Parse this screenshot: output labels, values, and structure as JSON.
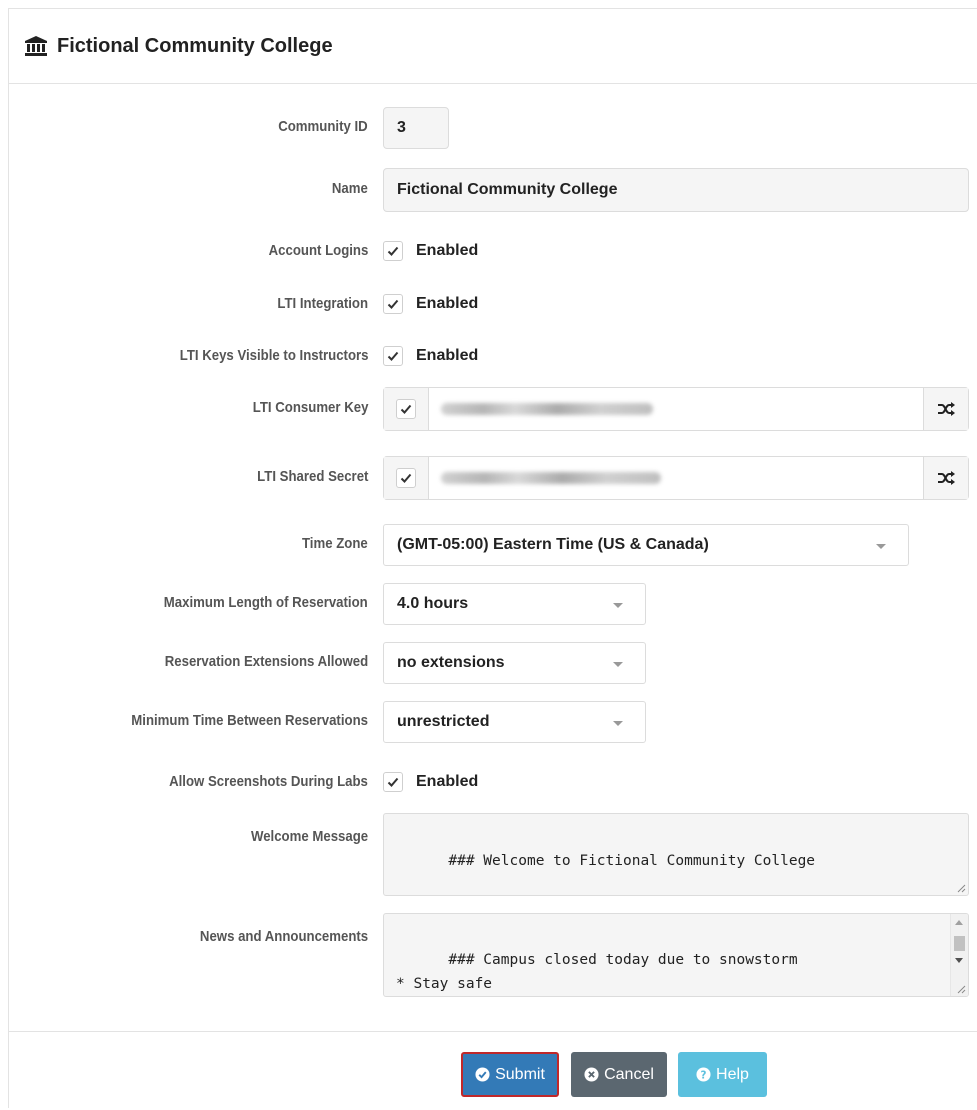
{
  "header": {
    "title": "Fictional Community College",
    "icon": "university-icon"
  },
  "form": {
    "community_id": {
      "label": "Community ID",
      "value": "3"
    },
    "name": {
      "label": "Name",
      "value": "Fictional Community College"
    },
    "account_logins": {
      "label": "Account Logins",
      "checked": true,
      "text": "Enabled"
    },
    "lti_integration": {
      "label": "LTI Integration",
      "checked": true,
      "text": "Enabled"
    },
    "lti_keys_visible": {
      "label": "LTI Keys Visible to Instructors",
      "checked": true,
      "text": "Enabled"
    },
    "lti_consumer_key": {
      "label": "LTI Consumer Key",
      "checked": true,
      "icon": "shuffle-icon"
    },
    "lti_shared_secret": {
      "label": "LTI Shared Secret",
      "checked": true,
      "icon": "shuffle-icon"
    },
    "time_zone": {
      "label": "Time Zone",
      "value": "(GMT-05:00) Eastern Time (US & Canada)"
    },
    "max_reservation": {
      "label": "Maximum Length of Reservation",
      "value": "4.0 hours"
    },
    "extensions": {
      "label": "Reservation Extensions Allowed",
      "value": "no extensions"
    },
    "min_time_between": {
      "label": "Minimum Time Between Reservations",
      "value": "unrestricted"
    },
    "allow_screenshots": {
      "label": "Allow Screenshots During Labs",
      "checked": true,
      "text": "Enabled"
    },
    "welcome_message": {
      "label": "Welcome Message",
      "value": "### Welcome to Fictional Community College"
    },
    "news": {
      "label": "News and Announcements",
      "value": "### Campus closed today due to snowstorm\n* Stay safe\n* Complete your assignments using NETLAB+"
    }
  },
  "buttons": {
    "submit": "Submit",
    "cancel": "Cancel",
    "help": "Help"
  },
  "colors": {
    "submit": "#337ab7",
    "submit_outline": "#c0282a",
    "cancel": "#5b6770",
    "help": "#5bc0de"
  }
}
